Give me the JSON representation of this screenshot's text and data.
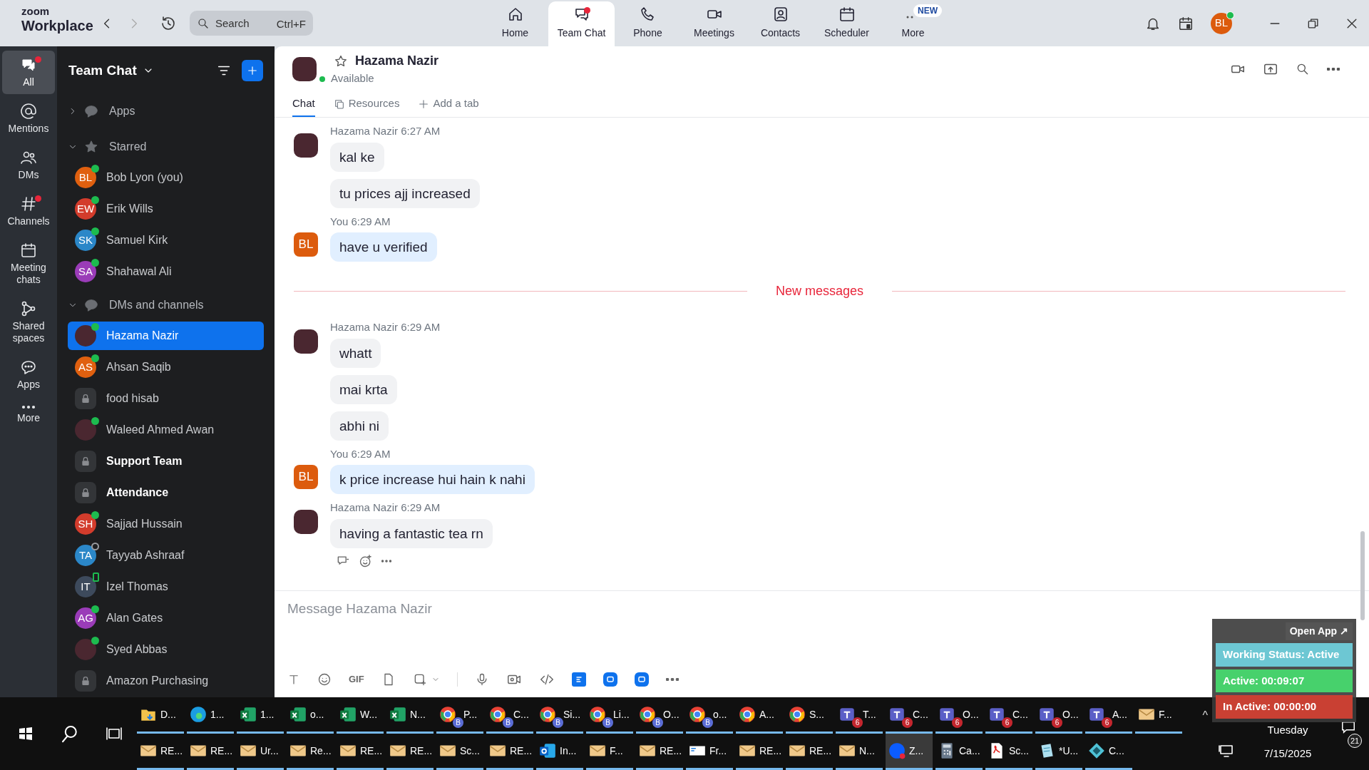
{
  "app": {
    "logo_top": "zoom",
    "logo_bottom": "Workplace",
    "search": {
      "placeholder": "Search",
      "shortcut": "Ctrl+F"
    }
  },
  "nav": [
    {
      "label": "Home",
      "selected": false,
      "dot": false
    },
    {
      "label": "Team Chat",
      "selected": true,
      "dot": true
    },
    {
      "label": "Phone",
      "selected": false,
      "dot": false
    },
    {
      "label": "Meetings",
      "selected": false,
      "dot": false
    },
    {
      "label": "Contacts",
      "selected": false,
      "dot": false
    },
    {
      "label": "Scheduler",
      "selected": false,
      "dot": false
    },
    {
      "label": "More",
      "selected": false,
      "dot": false,
      "badge": "NEW"
    }
  ],
  "profile": {
    "initials": "BL"
  },
  "rail": [
    {
      "label": "All",
      "selected": true,
      "dot": true
    },
    {
      "label": "Mentions",
      "selected": false,
      "dot": false
    },
    {
      "label": "DMs",
      "selected": false,
      "dot": false
    },
    {
      "label": "Channels",
      "selected": false,
      "dot": true
    },
    {
      "label": "Meeting chats",
      "selected": false,
      "dot": false
    },
    {
      "label": "Shared spaces",
      "selected": false,
      "dot": false
    },
    {
      "label": "Apps",
      "selected": false,
      "dot": false
    },
    {
      "label": "More",
      "selected": false,
      "dot": false
    }
  ],
  "sidebar": {
    "title": "Team Chat",
    "sections": [
      {
        "label": "Apps",
        "expanded": false
      },
      {
        "label": "Starred",
        "expanded": true,
        "items": [
          {
            "name": "Bob Lyon (you)",
            "kind": "initials",
            "initials": "BL",
            "color": "#e0600f",
            "online": true,
            "selected": false,
            "unread": false
          },
          {
            "name": "Erik Wills",
            "kind": "initials",
            "initials": "EW",
            "color": "#d33c2c",
            "online": true,
            "selected": false,
            "unread": false
          },
          {
            "name": "Samuel Kirk",
            "kind": "initials",
            "initials": "SK",
            "color": "#2b87c8",
            "online": true,
            "selected": false,
            "unread": false
          },
          {
            "name": "Shahawal Ali",
            "kind": "initials",
            "initials": "SA",
            "color": "#9a3cb8",
            "online": true,
            "selected": false,
            "unread": false
          }
        ]
      },
      {
        "label": "DMs and channels",
        "expanded": true,
        "items": [
          {
            "name": "Hazama Nazir",
            "kind": "photo",
            "online": true,
            "selected": true,
            "unread": false
          },
          {
            "name": "Ahsan Saqib",
            "kind": "initials",
            "initials": "AS",
            "color": "#e0600f",
            "online": true,
            "selected": false,
            "unread": false
          },
          {
            "name": "food hisab",
            "kind": "lock",
            "selected": false,
            "unread": false
          },
          {
            "name": "Waleed Ahmed Awan",
            "kind": "photo",
            "online": true,
            "selected": false,
            "unread": false
          },
          {
            "name": "Support Team",
            "kind": "lock",
            "selected": false,
            "unread": true
          },
          {
            "name": "Attendance",
            "kind": "lock",
            "selected": false,
            "unread": true
          },
          {
            "name": "Sajjad Hussain",
            "kind": "initials",
            "initials": "SH",
            "color": "#d33c2c",
            "online": true,
            "selected": false,
            "unread": false
          },
          {
            "name": "Tayyab Ashraaf",
            "kind": "initials",
            "initials": "TA",
            "color": "#2b87c8",
            "online": false,
            "selected": false,
            "unread": false
          },
          {
            "name": "Izel Thomas",
            "kind": "initials",
            "initials": "IT",
            "color": "#3d4a5c",
            "online": true,
            "mobile": true,
            "selected": false,
            "unread": false
          },
          {
            "name": "Alan Gates",
            "kind": "initials",
            "initials": "AG",
            "color": "#9a3cb8",
            "online": true,
            "selected": false,
            "unread": false
          },
          {
            "name": "Syed Abbas",
            "kind": "photo",
            "online": true,
            "selected": false,
            "unread": false
          },
          {
            "name": "Amazon Purchasing",
            "kind": "lock",
            "selected": false,
            "unread": false
          }
        ]
      }
    ]
  },
  "chat": {
    "name": "Hazama Nazir",
    "starred": false,
    "status": "Available",
    "tabs": [
      {
        "label": "Chat",
        "selected": true
      },
      {
        "label": "Resources",
        "selected": false
      },
      {
        "label": "Add a tab",
        "selected": false
      }
    ],
    "timeline": [
      {
        "kind": "group",
        "sender": "Hazama Nazir",
        "time": "6:27 AM",
        "mine": false,
        "messages": [
          "kal ke",
          "tu prices ajj increased"
        ]
      },
      {
        "kind": "group",
        "sender": "You",
        "time": "6:29 AM",
        "mine": true,
        "initials": "BL",
        "messages": [
          "have u verified"
        ]
      },
      {
        "kind": "divider",
        "label": "New messages"
      },
      {
        "kind": "group",
        "sender": "Hazama Nazir",
        "time": "6:29 AM",
        "mine": false,
        "messages": [
          "whatt",
          "mai krta",
          "abhi ni"
        ]
      },
      {
        "kind": "group",
        "sender": "You",
        "time": "6:29 AM",
        "mine": true,
        "initials": "BL",
        "messages": [
          "k price increase hui hain k nahi"
        ]
      },
      {
        "kind": "group",
        "sender": "Hazama Nazir",
        "time": "6:29 AM",
        "mine": false,
        "messages": [
          "having a fantastic tea rn"
        ],
        "actions": true
      }
    ],
    "composer": {
      "placeholder": "Message Hazama Nazir",
      "gif": "GIF"
    }
  },
  "tracker": {
    "open_app": "Open App ↗",
    "working": "Working Status: Active",
    "active": "Active: 00:09:07",
    "inactive": "In Active: 00:00:00"
  },
  "taskbar": {
    "row_1": [
      {
        "kind": "folder",
        "label": "D..."
      },
      {
        "kind": "edge",
        "label": "1..."
      },
      {
        "kind": "excel",
        "label": "1..."
      },
      {
        "kind": "excel",
        "label": "o..."
      },
      {
        "kind": "excel",
        "label": "W..."
      },
      {
        "kind": "excel",
        "label": "N..."
      },
      {
        "kind": "chrome",
        "label": "P...",
        "badge": "B"
      },
      {
        "kind": "chrome",
        "label": "C...",
        "badge": "B"
      },
      {
        "kind": "chrome",
        "label": "Si...",
        "badge": "B"
      },
      {
        "kind": "chrome",
        "label": "Li...",
        "badge": "B"
      },
      {
        "kind": "chrome",
        "label": "O...",
        "badge": "B"
      },
      {
        "kind": "chrome",
        "label": "o...",
        "badge": "B"
      },
      {
        "kind": "chrome",
        "label": "A..."
      },
      {
        "kind": "chrome",
        "label": "S..."
      },
      {
        "kind": "teams",
        "label": "T...",
        "badge": "6"
      },
      {
        "kind": "teams",
        "label": "C...",
        "badge": "6"
      },
      {
        "kind": "teams",
        "label": "O...",
        "badge": "6"
      },
      {
        "kind": "teams",
        "label": "C...",
        "badge": "6"
      },
      {
        "kind": "teams",
        "label": "O...",
        "badge": "6"
      },
      {
        "kind": "teams",
        "label": "A...",
        "badge": "6"
      },
      {
        "kind": "mail",
        "label": "F..."
      }
    ],
    "row_2": [
      {
        "kind": "mail",
        "label": "RE..."
      },
      {
        "kind": "mail",
        "label": "RE..."
      },
      {
        "kind": "mail",
        "label": "Ur..."
      },
      {
        "kind": "mail",
        "label": "Re..."
      },
      {
        "kind": "mail",
        "label": "RE..."
      },
      {
        "kind": "mail",
        "label": "RE..."
      },
      {
        "kind": "mail",
        "label": "Sc..."
      },
      {
        "kind": "mail",
        "label": "RE..."
      },
      {
        "kind": "outlook",
        "label": "In..."
      },
      {
        "kind": "mail",
        "label": "F..."
      },
      {
        "kind": "mail",
        "label": "RE..."
      },
      {
        "kind": "letter",
        "label": "Fr..."
      },
      {
        "kind": "mail",
        "label": "RE..."
      },
      {
        "kind": "mail",
        "label": "RE..."
      },
      {
        "kind": "mail",
        "label": "N..."
      },
      {
        "kind": "zoom",
        "label": "Z...",
        "selected": true
      },
      {
        "kind": "calc",
        "label": "Ca..."
      },
      {
        "kind": "pdf",
        "label": "Sc..."
      },
      {
        "kind": "notepad",
        "label": "*U..."
      },
      {
        "kind": "app",
        "label": "C..."
      }
    ],
    "tray_arrow": "^",
    "day": "Tuesday",
    "date": "7/15/2025",
    "notifications": "21"
  }
}
